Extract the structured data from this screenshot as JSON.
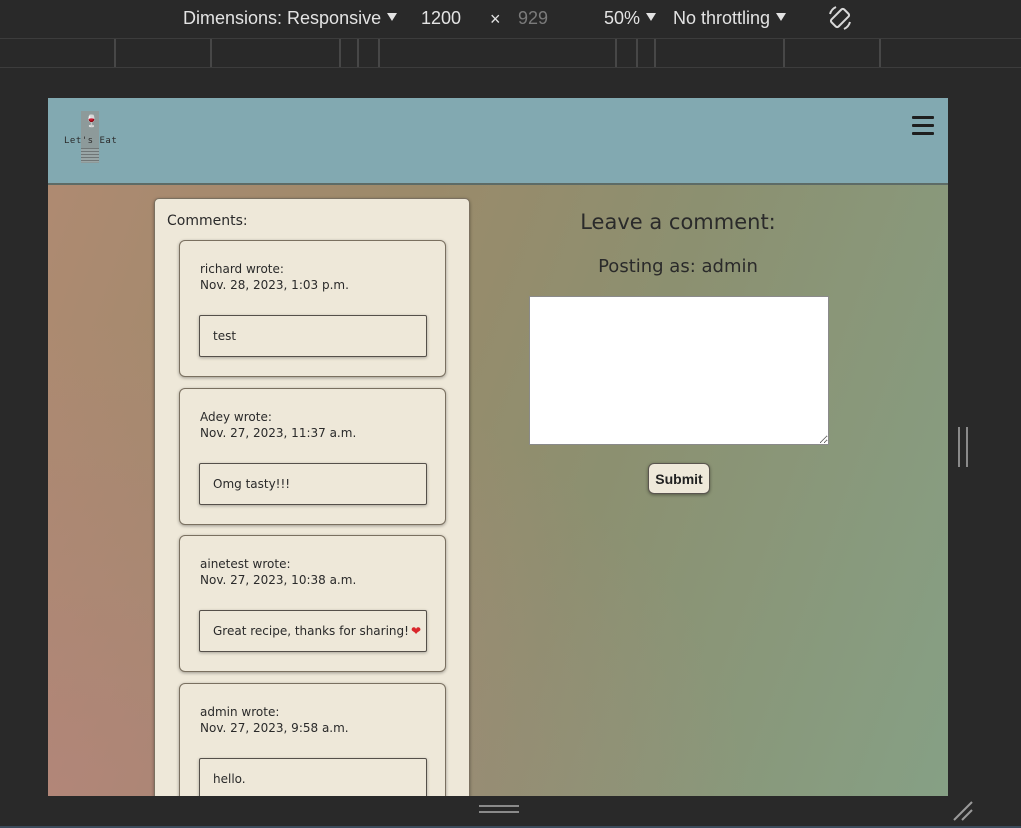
{
  "devtools": {
    "dimensions_label": "Dimensions: Responsive",
    "width_value": "1200",
    "times_symbol": "×",
    "height_value": "929",
    "zoom_label": "50%",
    "throttling_label": "No throttling",
    "rotate_icon": "rotate-icon"
  },
  "header": {
    "logo_glass": "🍷",
    "logo_text": "Let's Eat",
    "menu_icon": "hamburger-menu-icon",
    "bg_color": "#82a9b1"
  },
  "comments": {
    "title": "Comments:",
    "items": [
      {
        "author": "richard wrote:",
        "date": "Nov. 28, 2023, 1:03 p.m.",
        "body": "test"
      },
      {
        "author": "Adey wrote:",
        "date": "Nov. 27, 2023, 11:37 a.m.",
        "body": "Omg tasty!!!"
      },
      {
        "author": "ainetest wrote:",
        "date": "Nov. 27, 2023, 10:38 a.m.",
        "body": "Great recipe, thanks for sharing!",
        "emoji": "❤"
      },
      {
        "author": "admin wrote:",
        "date": "Nov. 27, 2023, 9:58 a.m.",
        "body": "hello."
      }
    ]
  },
  "form": {
    "title": "Leave a comment:",
    "posting_as": "Posting as: admin",
    "textarea_value": "",
    "submit_label": "Submit"
  }
}
